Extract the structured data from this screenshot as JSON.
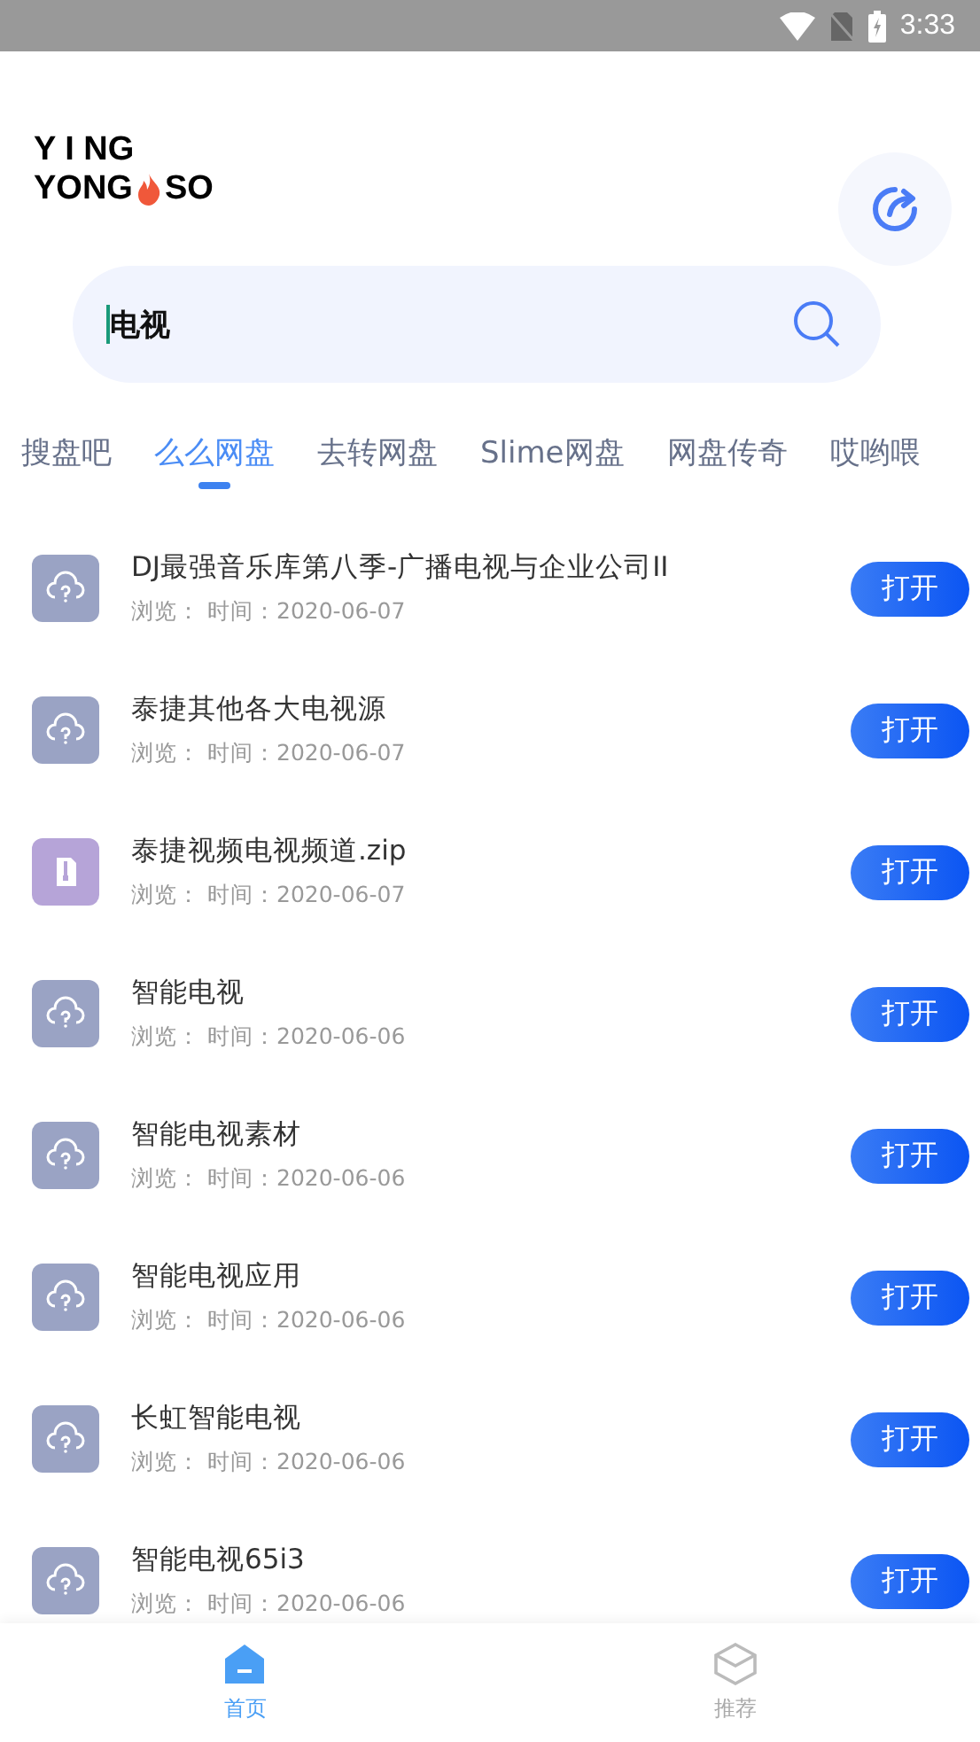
{
  "status_bar": {
    "time": "3:33"
  },
  "logo": {
    "line1": "Y I NG",
    "line2_left": "YONG",
    "line2_right": "SO"
  },
  "search": {
    "value": "电视"
  },
  "tabs": [
    {
      "label": "搜盘吧",
      "selected": false
    },
    {
      "label": "么么网盘",
      "selected": true
    },
    {
      "label": "去转网盘",
      "selected": false
    },
    {
      "label": "Slime网盘",
      "selected": false
    },
    {
      "label": "网盘传奇",
      "selected": false
    },
    {
      "label": "哎哟喂",
      "selected": false
    }
  ],
  "results": [
    {
      "kind": "cloud",
      "title": "DJ最强音乐库第八季-广播电视与企业公司II",
      "views": "浏览：",
      "time": "时间：2020-06-07",
      "button": "打开"
    },
    {
      "kind": "cloud",
      "title": "泰捷其他各大电视源",
      "views": "浏览：",
      "time": "时间：2020-06-07",
      "button": "打开"
    },
    {
      "kind": "zip",
      "title": "泰捷视频电视频道.zip",
      "views": "浏览：",
      "time": "时间：2020-06-07",
      "button": "打开"
    },
    {
      "kind": "cloud",
      "title": "智能电视",
      "views": "浏览：",
      "time": "时间：2020-06-06",
      "button": "打开"
    },
    {
      "kind": "cloud",
      "title": "智能电视素材",
      "views": "浏览：",
      "time": "时间：2020-06-06",
      "button": "打开"
    },
    {
      "kind": "cloud",
      "title": "智能电视应用",
      "views": "浏览：",
      "time": "时间：2020-06-06",
      "button": "打开"
    },
    {
      "kind": "cloud",
      "title": "长虹智能电视",
      "views": "浏览：",
      "time": "时间：2020-06-06",
      "button": "打开"
    },
    {
      "kind": "cloud",
      "title": "智能电视65i3",
      "views": "浏览：",
      "time": "时间：2020-06-06",
      "button": "打开"
    }
  ],
  "bottom_nav": [
    {
      "kind": "home",
      "label": "首页",
      "selected": true
    },
    {
      "kind": "box",
      "label": "推荐",
      "selected": false
    }
  ]
}
